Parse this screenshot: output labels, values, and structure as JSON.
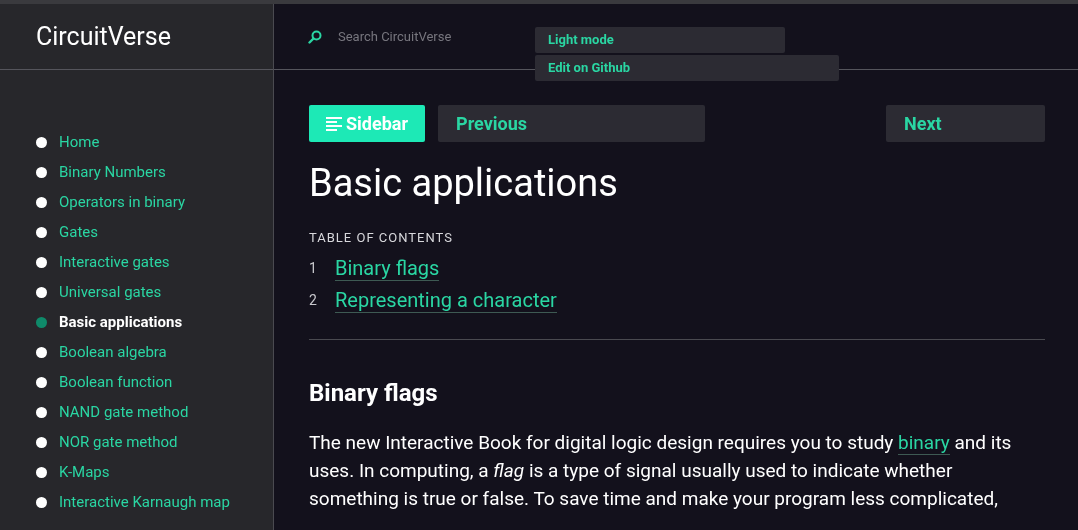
{
  "brand": "CircuitVerse",
  "search": {
    "placeholder": "Search CircuitVerse"
  },
  "menu": [
    {
      "label": "Light mode"
    },
    {
      "label": "Edit on Github"
    }
  ],
  "sidebar": {
    "items": [
      {
        "label": "Home",
        "selected": false
      },
      {
        "label": "Binary Numbers",
        "selected": false
      },
      {
        "label": "Operators in binary",
        "selected": false
      },
      {
        "label": "Gates",
        "selected": false
      },
      {
        "label": "Interactive gates",
        "selected": false
      },
      {
        "label": "Universal gates",
        "selected": false
      },
      {
        "label": "Basic applications",
        "selected": true
      },
      {
        "label": "Boolean algebra",
        "selected": false
      },
      {
        "label": "Boolean function",
        "selected": false
      },
      {
        "label": "NAND gate method",
        "selected": false
      },
      {
        "label": "NOR gate method",
        "selected": false
      },
      {
        "label": "K-Maps",
        "selected": false
      },
      {
        "label": "Interactive Karnaugh map",
        "selected": false
      }
    ]
  },
  "nav": {
    "sidebar": "Sidebar",
    "previous": "Previous",
    "next": "Next"
  },
  "title": "Basic applications",
  "toc": {
    "heading": "TABLE OF CONTENTS",
    "items": [
      {
        "number": "1",
        "label": "Binary flags"
      },
      {
        "number": "2",
        "label": "Representing a character"
      }
    ]
  },
  "section": {
    "heading": "Binary flags",
    "before": "The new Interactive Book for digital logic design requires you to study",
    "link": "binary",
    "after": "and its uses. In computing, a *flag* is a type of signal usually used to indicate whether something is true or false. To save time and make your program less complicated,"
  }
}
